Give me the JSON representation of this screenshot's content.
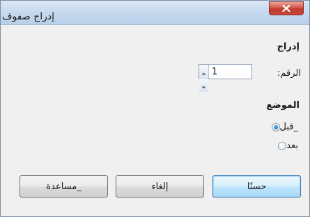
{
  "window": {
    "title": "إدراج صفوف",
    "close_icon": "close-icon"
  },
  "insert_group": {
    "label": "إدراج",
    "number_label": "الرقم:",
    "number_value": "1"
  },
  "position_group": {
    "label": "الموضع",
    "options": [
      {
        "label": "_قبل",
        "checked": true
      },
      {
        "label": "بعد",
        "checked": false
      }
    ]
  },
  "buttons": {
    "ok": "حسنًا",
    "cancel": "إلغاء",
    "help": "_مساعدة"
  },
  "colors": {
    "accent": "#3c7fb1",
    "close": "#c0392b",
    "titlebar": "#c6d9ef"
  }
}
